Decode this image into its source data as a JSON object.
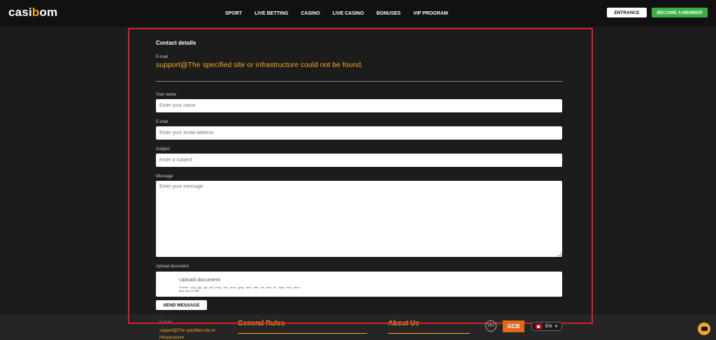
{
  "header": {
    "logo_main": "casi",
    "logo_accent": "b",
    "logo_end": "om",
    "nav": [
      "SPORT",
      "LIVE BETTING",
      "CASINO",
      "LIVE CASINO",
      "BONUSES",
      "VIP PROGRAM"
    ],
    "entrance_label": "ENTRANCE",
    "member_label": "BECOME A MEMBER"
  },
  "contact": {
    "title": "Contact details",
    "email_label": "E-mail",
    "email_value": "support@The specified site or infrastructure could not be found."
  },
  "form": {
    "name_label": "Your name",
    "name_placeholder": "Enter your name",
    "email_label": "E-mail",
    "email_placeholder": "Enter your email address",
    "subject_label": "Subject",
    "subject_placeholder": "Enter a subject",
    "message_label": "Message",
    "message_placeholder": "Enter your message",
    "upload_label": "Upload document",
    "upload_title": "Upload document",
    "upload_formats": "Format : .png, .jpg, .gif, .pdf, .bmp, .doc, .docx, .jpeg, .html, .htm, .xls, .xlsx, .txt, .mp4, .mov, .wmv",
    "upload_max": "Max size 10 MB",
    "send_label": "SEND MESSAGE"
  },
  "footer": {
    "email_label": "E-mail",
    "email_value": "support@The specified site or Infrastructure",
    "general_rules": "General Rules",
    "about_us": "About Us",
    "age_badge": "18+",
    "gcb_badge": "GCB",
    "language": "EN"
  },
  "colors": {
    "accent": "#f5a623",
    "member_button": "#3cb043",
    "highlight_border": "#d8202a"
  }
}
